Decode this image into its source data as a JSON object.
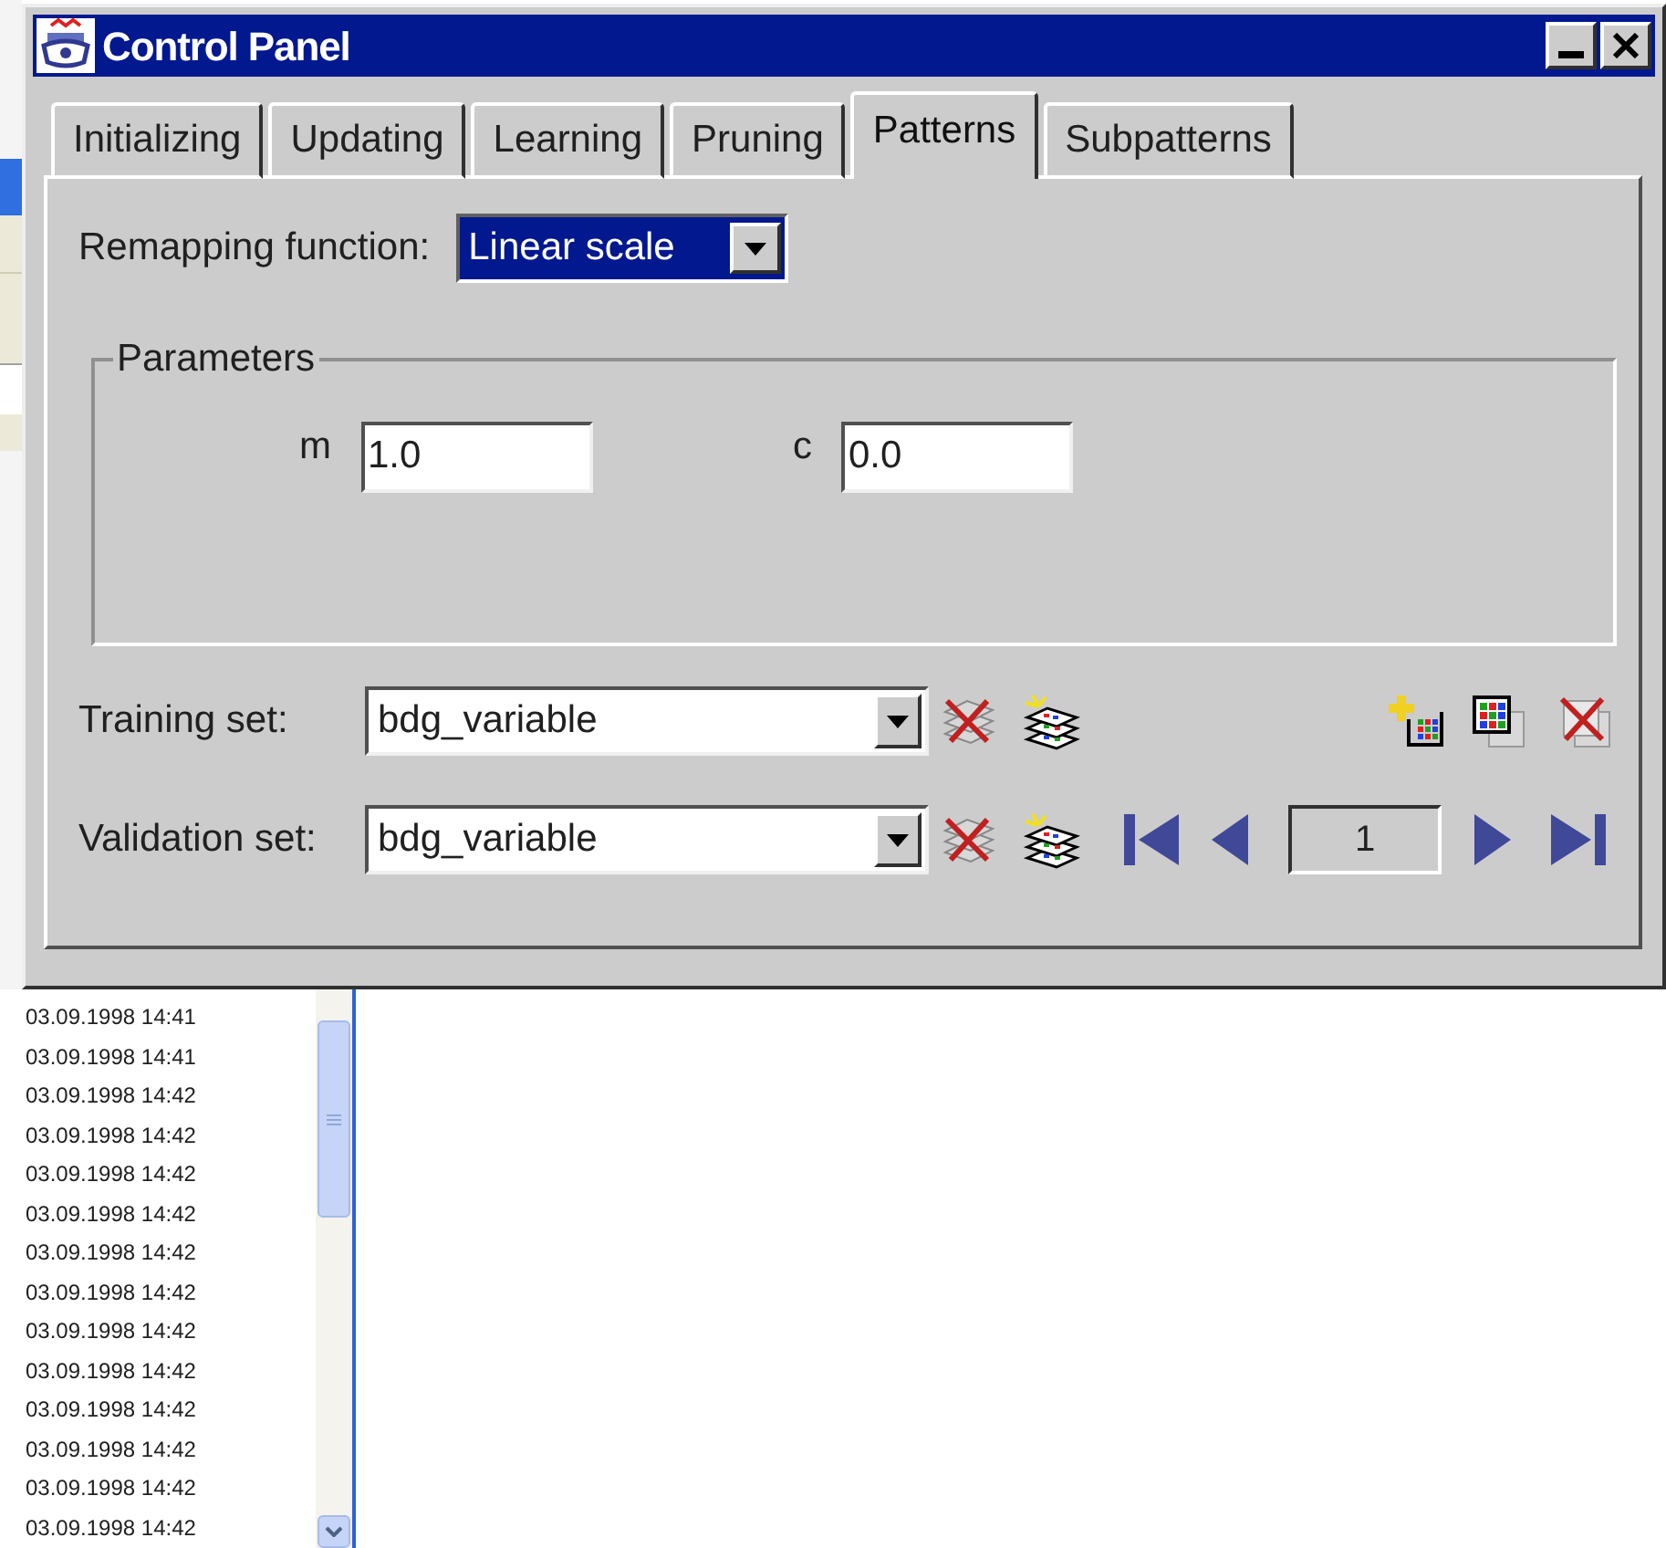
{
  "window": {
    "title": "Control Panel"
  },
  "tabs": [
    {
      "label": "Initializing",
      "selected": false
    },
    {
      "label": "Updating",
      "selected": false
    },
    {
      "label": "Learning",
      "selected": false
    },
    {
      "label": "Pruning",
      "selected": false
    },
    {
      "label": "Patterns",
      "selected": true
    },
    {
      "label": "Subpatterns",
      "selected": false
    }
  ],
  "remapping": {
    "label": "Remapping function:",
    "value": "Linear scale"
  },
  "parameters": {
    "title": "Parameters",
    "fields": [
      {
        "label": "m",
        "value": "1.0"
      },
      {
        "label": "c",
        "value": "0.0"
      }
    ]
  },
  "sets": [
    {
      "label": "Training set:",
      "value": "bdg_variable"
    },
    {
      "label": "Validation set:",
      "value": "bdg_variable"
    }
  ],
  "pattern_index": "1",
  "log": {
    "rows": [
      "03.09.1998 14:41",
      "03.09.1998 14:41",
      "03.09.1998 14:42",
      "03.09.1998 14:42",
      "03.09.1998 14:42",
      "03.09.1998 14:42",
      "03.09.1998 14:42",
      "03.09.1998 14:42",
      "03.09.1998 14:42",
      "03.09.1998 14:42",
      "03.09.1998 14:42",
      "03.09.1998 14:42",
      "03.09.1998 14:42",
      "03.09.1998 14:42"
    ]
  }
}
